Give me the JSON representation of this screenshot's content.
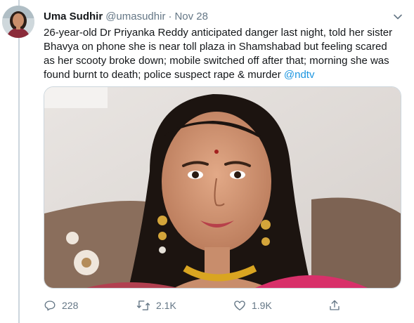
{
  "tweet": {
    "author_name": "Uma Sudhir",
    "handle": "@umasudhir",
    "separator": "·",
    "time": "Nov 28",
    "text_before_mention": "26-year-old Dr Priyanka Reddy anticipated danger last night, told her sister Bhavya on phone she is near toll plaza in Shamshabad but feeling scared as her scooty broke down; mobile switched off after that; morning she was found burnt to death; police suspect rape & murder ",
    "mention": "@ndtv"
  },
  "actions": {
    "reply_count": "228",
    "retweet_count": "2.1K",
    "like_count": "1.9K"
  },
  "icons": {
    "caret": "chevron-down-icon",
    "reply": "reply-icon",
    "retweet": "retweet-icon",
    "like": "heart-icon",
    "share": "share-icon"
  },
  "colors": {
    "accent": "#1b95e0",
    "secondary_text": "#657786",
    "primary_text": "#14171a",
    "border": "#ccd6dd"
  }
}
